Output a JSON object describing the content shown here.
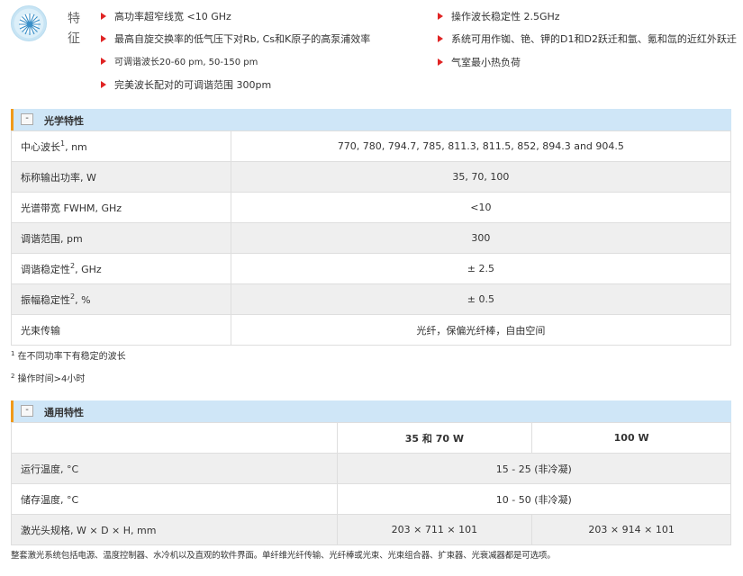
{
  "features": {
    "title": "特征",
    "left": [
      "高功率超窄线宽 <10 GHz",
      "最高自旋交换率的低气压下对Rb, Cs和K原子的高泵浦效率",
      "可调谐波长20-60 pm, 50-150 pm",
      "完美波长配对的可调谐范围 300pm"
    ],
    "right": [
      "操作波长稳定性 2.5GHz",
      "系统可用作铷、铯、钾的D1和D2跃迁和氩、氪和氙的近红外跃迁",
      "气室最小热负荷"
    ]
  },
  "optical": {
    "toggle": "-",
    "title": "光学特性",
    "rows": [
      {
        "label": "中心波长",
        "sup": "1",
        "unit": ", nm",
        "value": "770, 780, 794.7, 785, 811.3, 811.5, 852, 894.3 and 904.5"
      },
      {
        "label": "标称输出功率, W",
        "sup": "",
        "unit": "",
        "value": "35, 70, 100"
      },
      {
        "label": "光谱带宽 FWHM, GHz",
        "sup": "",
        "unit": "",
        "value": "<10"
      },
      {
        "label": "调谐范围, pm",
        "sup": "",
        "unit": "",
        "value": "300"
      },
      {
        "label": "调谐稳定性",
        "sup": "2",
        "unit": ", GHz",
        "value": "± 2.5"
      },
      {
        "label": "振幅稳定性",
        "sup": "2",
        "unit": ", %",
        "value": "± 0.5"
      },
      {
        "label": "光束传输",
        "sup": "",
        "unit": "",
        "value": "光纤，保偏光纤棒，自由空间"
      }
    ],
    "footnotes": [
      {
        "mark": "1",
        "text": "在不同功率下有稳定的波长"
      },
      {
        "mark": "2",
        "text": "操作时间>4小时"
      }
    ]
  },
  "general": {
    "toggle": "-",
    "title": "通用特性",
    "headers": [
      "",
      "35 和 70 W",
      "100 W"
    ],
    "rows": [
      {
        "label": "运行温度, °C",
        "merged": "15 - 25 (非冷凝)"
      },
      {
        "label": "储存温度, °C",
        "merged": "10 - 50 (非冷凝)"
      },
      {
        "label": "激光头规格, W × D × H, mm",
        "a": "203 × 711 × 101",
        "b": "203 × 914 × 101"
      }
    ]
  },
  "bottom_note": "整套激光系统包括电源、温度控制器、水冷机以及直观的软件界面。单纤维光纤传输、光纤棒或光束、光束组合器、扩束器、光衰减器都是可选项。",
  "colors": {
    "accent_red": "#e02424",
    "header_bg": "#cfe6f7",
    "header_accent": "#f09a1a"
  }
}
